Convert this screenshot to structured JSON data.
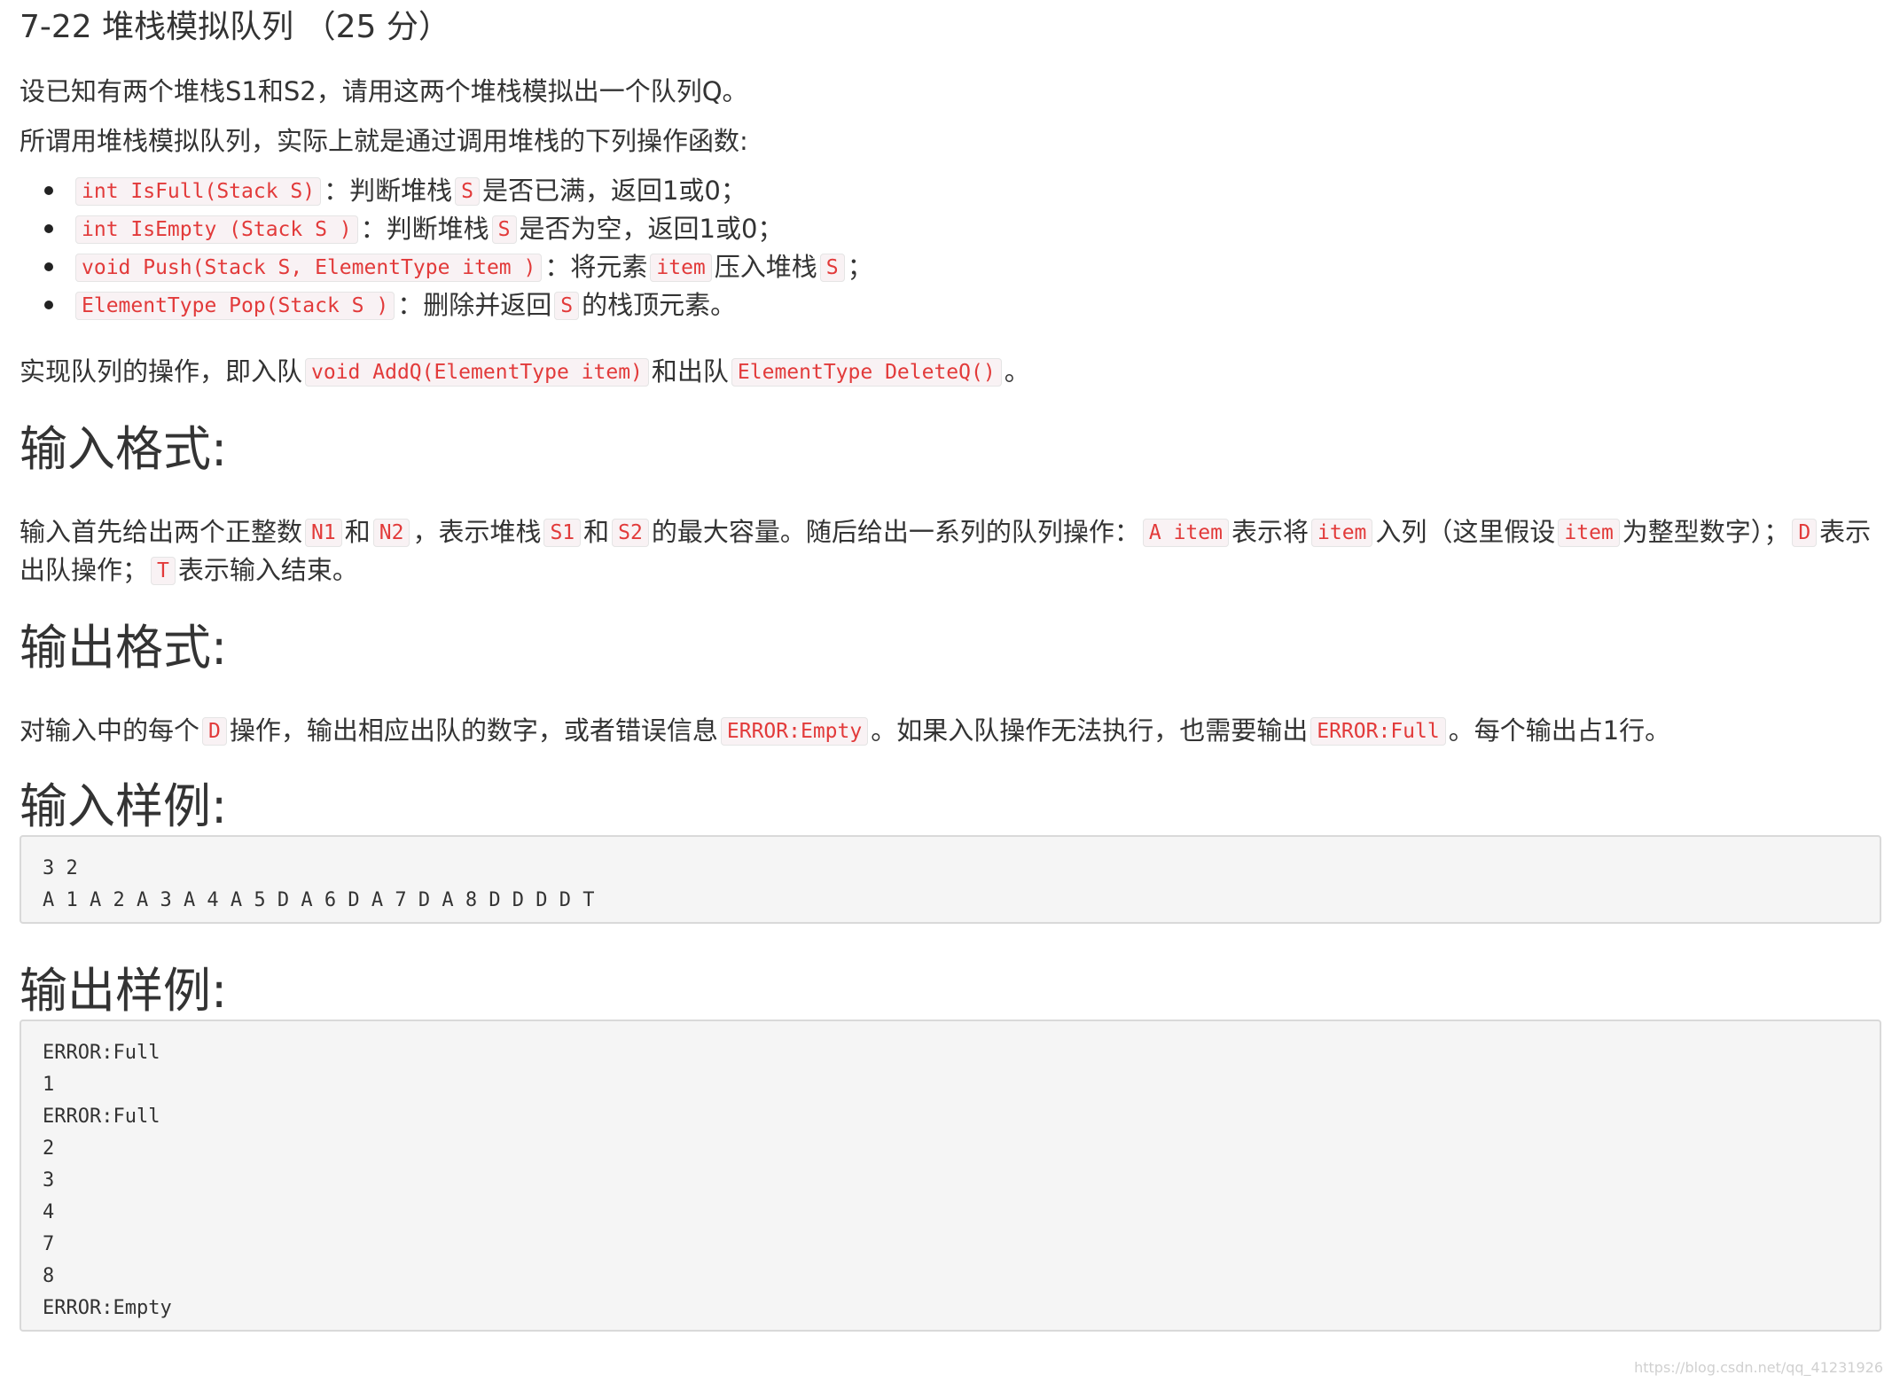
{
  "title": "7-22 堆栈模拟队列 （25 分）",
  "intro": {
    "line1": "设已知有两个堆栈S1和S2，请用这两个堆栈模拟出一个队列Q。",
    "line2": "所谓用堆栈模拟队列，实际上就是通过调用堆栈的下列操作函数:"
  },
  "ops": [
    {
      "code": "int IsFull(Stack S)",
      "t1": "：判断堆栈",
      "c2": "S",
      "t2": "是否已满，返回1或0；"
    },
    {
      "code": "int IsEmpty (Stack S )",
      "t1": "：判断堆栈",
      "c2": "S",
      "t2": "是否为空，返回1或0；"
    },
    {
      "code": "void Push(Stack S, ElementType item )",
      "t1": "：将元素",
      "c2": "item",
      "t2": "压入堆栈",
      "c3": "S",
      "t3": "；"
    },
    {
      "code": "ElementType Pop(Stack S )",
      "t1": "：删除并返回",
      "c2": "S",
      "t2": "的栈顶元素。"
    }
  ],
  "impl": {
    "t1": "实现队列的操作，即入队",
    "c1": "void AddQ(ElementType item)",
    "t2": "和出队",
    "c2": "ElementType DeleteQ()",
    "t3": "。"
  },
  "input_format": {
    "heading": "输入格式:",
    "t1": "输入首先给出两个正整数",
    "c1": "N1",
    "t2": "和",
    "c2": "N2",
    "t3": "，表示堆栈",
    "c3": "S1",
    "t4": "和",
    "c4": "S2",
    "t5": "的最大容量。随后给出一系列的队列操作：",
    "c5": "A item",
    "t6": "表示将",
    "c6": "item",
    "t7": "入列（这里假设",
    "c7": "item",
    "t8": "为整型数字）；",
    "c8": "D",
    "t9": "表示出队操作；",
    "c9": "T",
    "t10": "表示输入结束。"
  },
  "output_format": {
    "heading": "输出格式:",
    "t1": "对输入中的每个",
    "c1": "D",
    "t2": "操作，输出相应出队的数字，或者错误信息",
    "c2": "ERROR:Empty",
    "t3": "。如果入队操作无法执行，也需要输出",
    "c3": "ERROR:Full",
    "t4": "。每个输出占1行。"
  },
  "sample_input": {
    "heading": "输入样例:",
    "text": "3 2\nA 1 A 2 A 3 A 4 A 5 D A 6 D A 7 D A 8 D D D D T"
  },
  "sample_output": {
    "heading": "输出样例:",
    "text": "ERROR:Full\n1\nERROR:Full\n2\n3\n4\n7\n8\nERROR:Empty"
  },
  "watermark": "https://blog.csdn.net/qq_41231926",
  "colors": {
    "code_text": "#e23a3a",
    "code_bg": "#f9f2f4",
    "pre_bg": "#f5f5f5"
  }
}
